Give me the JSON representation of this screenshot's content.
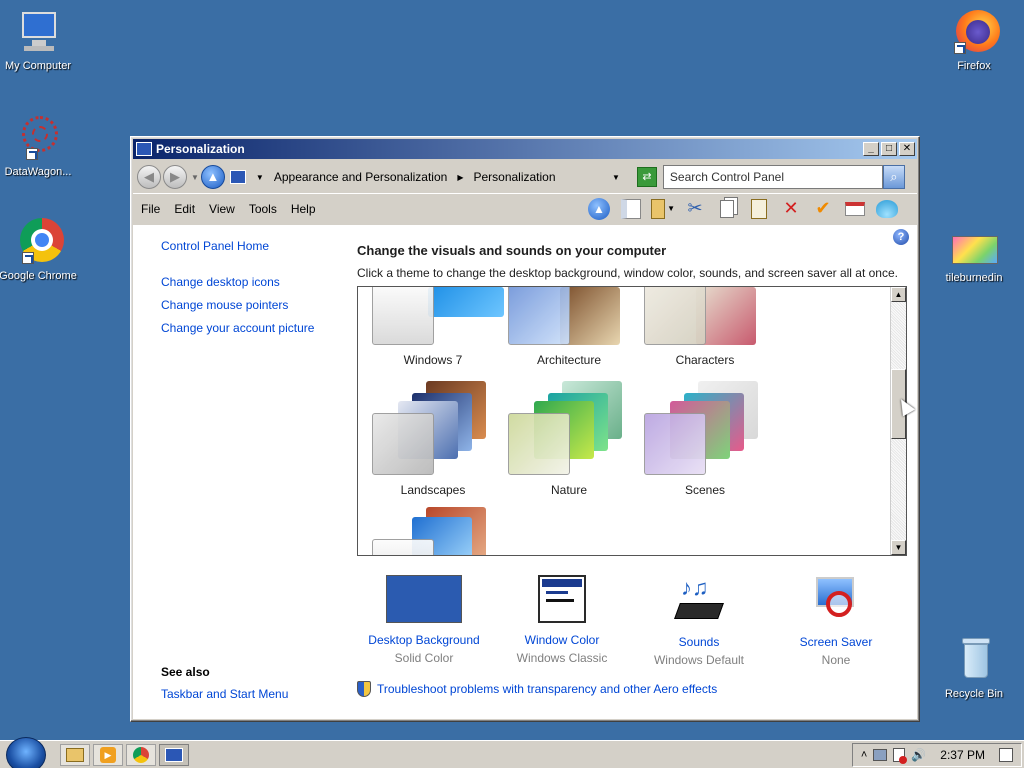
{
  "desktop": {
    "icons": [
      {
        "label": "My Computer"
      },
      {
        "label": "DataWagon..."
      },
      {
        "label": "Google Chrome"
      },
      {
        "label": "Firefox"
      },
      {
        "label": "tileburnedin"
      },
      {
        "label": "Recycle Bin"
      }
    ]
  },
  "window": {
    "title": "Personalization",
    "breadcrumb": [
      "Appearance and Personalization",
      "Personalization"
    ],
    "search_placeholder": "Search Control Panel",
    "menu": [
      "File",
      "Edit",
      "View",
      "Tools",
      "Help"
    ]
  },
  "left_pane": {
    "home": "Control Panel Home",
    "links": [
      "Change desktop icons",
      "Change mouse pointers",
      "Change your account picture"
    ],
    "see_also_title": "See also",
    "see_also_link": "Taskbar and Start Menu"
  },
  "main": {
    "heading": "Change the visuals and sounds on your computer",
    "subheading": "Click a theme to change the desktop background, window color, sounds, and screen saver all at once.",
    "themes": [
      {
        "name": "Windows 7"
      },
      {
        "name": "Architecture"
      },
      {
        "name": "Characters"
      },
      {
        "name": "Landscapes"
      },
      {
        "name": "Nature"
      },
      {
        "name": "Scenes"
      }
    ],
    "bottom": [
      {
        "label": "Desktop Background",
        "value": "Solid Color"
      },
      {
        "label": "Window Color",
        "value": "Windows Classic"
      },
      {
        "label": "Sounds",
        "value": "Windows Default"
      },
      {
        "label": "Screen Saver",
        "value": "None"
      }
    ],
    "troubleshoot": "Troubleshoot problems with transparency and other Aero effects"
  },
  "taskbar": {
    "clock": "2:37 PM"
  },
  "colors": {
    "desktop": "#3a6ea5",
    "link": "#0046d5",
    "accent_blue": "#2b5bb0"
  }
}
